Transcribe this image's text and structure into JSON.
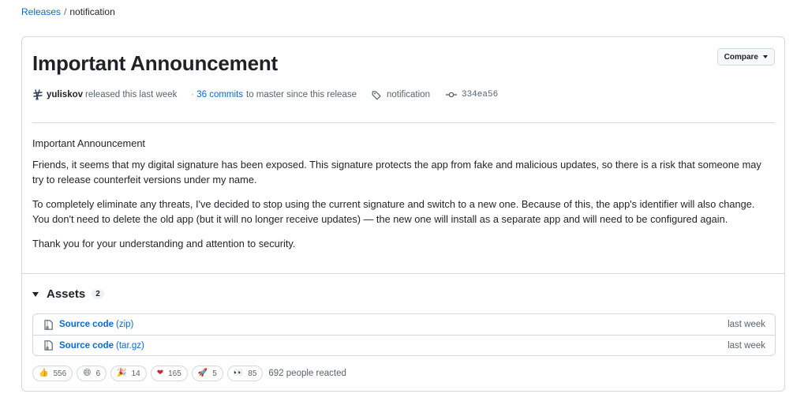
{
  "breadcrumb": {
    "parent": "Releases",
    "separator": "/",
    "current": "notification"
  },
  "release": {
    "title": "Important Announcement",
    "compare_label": "Compare",
    "author": "yuliskov",
    "released_text": "released this last week",
    "commits_link": "36 commits",
    "commits_text": "to master since this release",
    "tag": "notification",
    "commit_sha": "334ea56"
  },
  "body": {
    "heading": "Important Announcement",
    "paragraphs": [
      "Friends, it seems that my digital signature has been exposed. This signature protects the app from fake and malicious updates, so there is a risk that someone may try to release counterfeit versions under my name.",
      "To completely eliminate any threats, I've decided to stop using the current signature and switch to a new one. Because of this, the app's identifier will also change. You don't need to delete the old app (but it will no longer receive updates) — the new one will install as a separate app and will need to be configured again.",
      "Thank you for your understanding and attention to security."
    ]
  },
  "assets": {
    "title": "Assets",
    "count": "2",
    "items": [
      {
        "name": "Source code",
        "ext": "(zip)",
        "time": "last week",
        "icon": "file-zip-icon"
      },
      {
        "name": "Source code",
        "ext": "(tar.gz)",
        "time": "last week",
        "icon": "file-zip-icon"
      }
    ]
  },
  "reactions": {
    "items": [
      {
        "emoji": "👍",
        "icon": "thumbs-up-icon",
        "count": "556"
      },
      {
        "emoji": "😄",
        "icon": "laugh-icon",
        "count": "6"
      },
      {
        "emoji": "🎉",
        "icon": "hooray-icon",
        "count": "14"
      },
      {
        "emoji": "❤",
        "icon": "heart-icon",
        "count": "165"
      },
      {
        "emoji": "🚀",
        "icon": "rocket-icon",
        "count": "5"
      },
      {
        "emoji": "👀",
        "icon": "eyes-icon",
        "count": "85"
      }
    ],
    "summary": "692 people reacted"
  },
  "colors": {
    "link": "#0969da",
    "text": "#1f2328",
    "muted": "#59636e",
    "border": "#d1d9e0",
    "heart": "#cf222e"
  }
}
